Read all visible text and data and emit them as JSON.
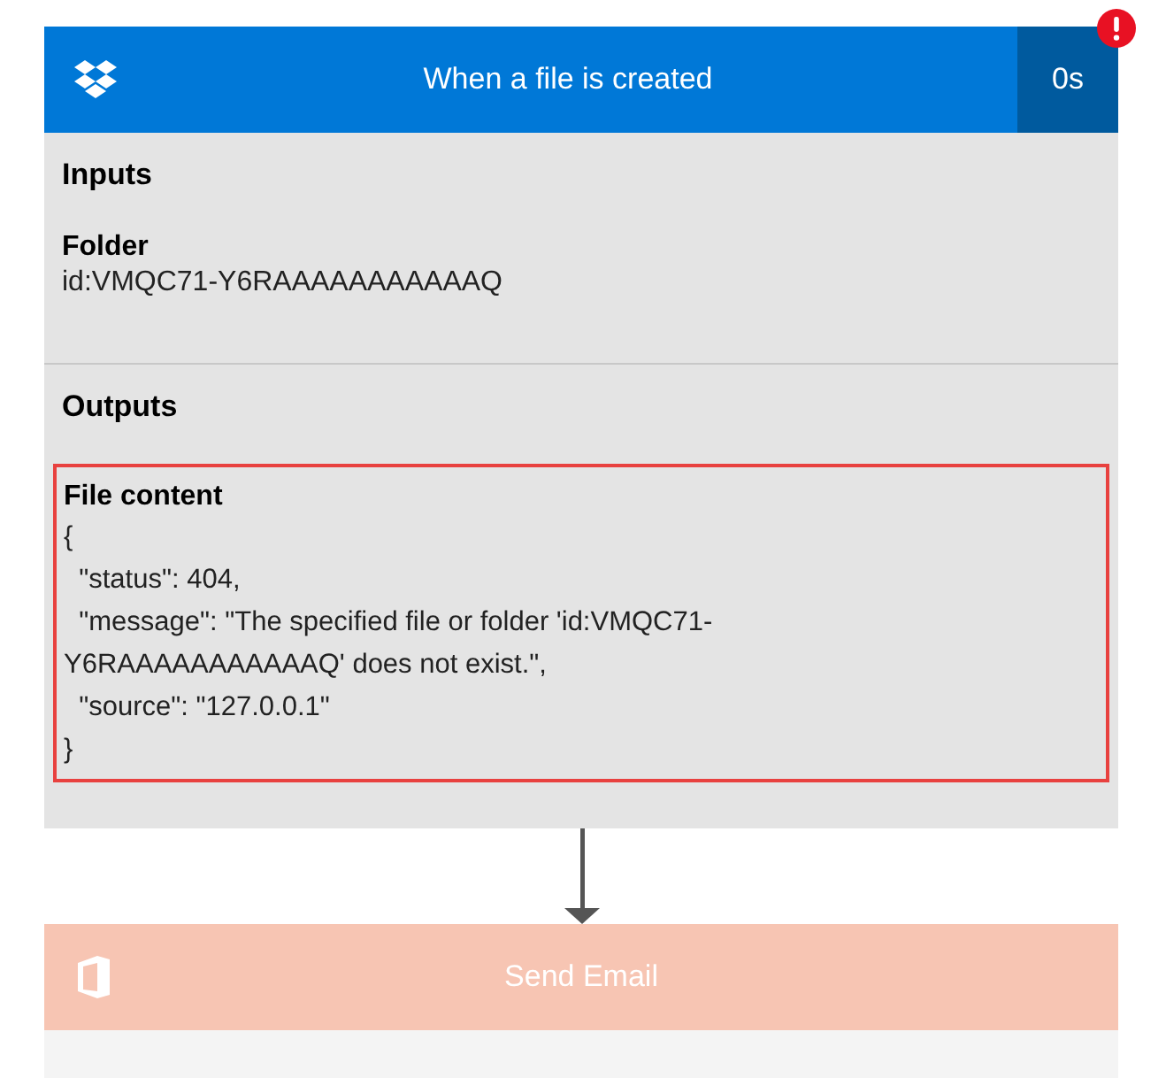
{
  "trigger": {
    "title": "When a file is created",
    "duration": "0s",
    "error": true,
    "inputs": {
      "heading": "Inputs",
      "fields": [
        {
          "label": "Folder",
          "value": "id:VMQC71-Y6RAAAAAAAAAAAQ"
        }
      ]
    },
    "outputs": {
      "heading": "Outputs",
      "fields": [
        {
          "label": "File content",
          "highlighted": true,
          "lines": [
            "{",
            "  \"status\": 404,",
            "  \"message\": \"The specified file or folder 'id:VMQC71-",
            "Y6RAAAAAAAAAAAQ' does not exist.\",",
            "  \"source\": \"127.0.0.1\"",
            "}"
          ]
        }
      ]
    }
  },
  "next_step": {
    "title": "Send Email",
    "disabled": true
  }
}
